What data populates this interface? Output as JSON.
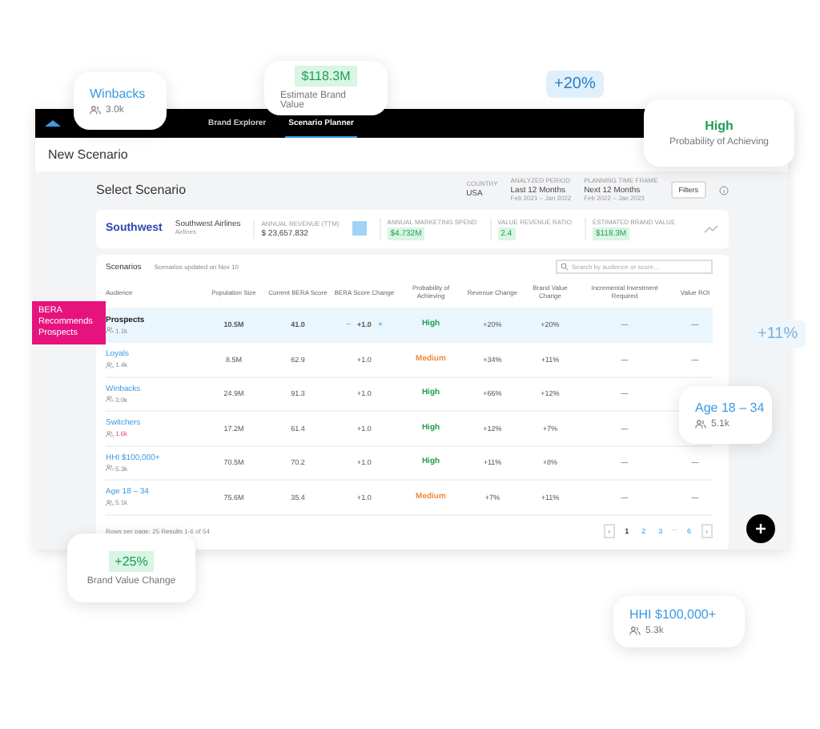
{
  "nav": {
    "tabs": [
      {
        "label": "Brand Explorer",
        "selected": false
      },
      {
        "label": "Scenario Planner",
        "selected": true
      }
    ]
  },
  "page_title": "New Scenario",
  "section_title": "Select Scenario",
  "context": [
    {
      "label": "COUNTRY",
      "value": "USA"
    },
    {
      "label": "ANALYZED PERIOD",
      "value": "Last 12 Months",
      "sub": "Feb 2021 – Jan 2022"
    },
    {
      "label": "PLANNING TIME FRAME",
      "value": "Next 12 Months",
      "sub": "Feb 2022 – Jan 2023"
    }
  ],
  "filters_button": "Filters",
  "brand": {
    "logo": "Southwest",
    "name": "Southwest Airlines",
    "category": "Airlines",
    "revenue_label": "ANNUAL REVENUE (TTM)",
    "currency": "$",
    "revenue": "23,657,832",
    "metrics": [
      {
        "label": "ANNUAL MARKETING SPEND",
        "value": "$4.732M"
      },
      {
        "label": "VALUE REVENUE RATIO",
        "value": "2.4"
      },
      {
        "label": "ESTIMATED BRAND VALUE",
        "value": "$118.3M"
      }
    ]
  },
  "scenarios": {
    "title": "Scenarios",
    "updated": "Scenarios updated on Nov 10",
    "search_placeholder": "Search by audience or score...",
    "columns": [
      "Audience",
      "Population Size",
      "Current BERA Score",
      "BERA Score Change",
      "Probability of Achieving",
      "Revenue Change",
      "Brand Value Change",
      "Incremental Investment Required",
      "Value ROI"
    ],
    "rows": [
      {
        "audience": "Prospects",
        "count": "1.1k",
        "flagged": false,
        "selected": true,
        "population": "10.5M",
        "score": "41.0",
        "minus": "−",
        "change": "+1.0",
        "plus": "+",
        "probability": "High",
        "color": "#1f9d55",
        "revenue": "+20%",
        "brand_value": "+20%",
        "investment": "—",
        "roi": "—"
      },
      {
        "audience": "Loyals",
        "count": "1.4k",
        "flagged": false,
        "selected": false,
        "population": "8.5M",
        "score": "62.9",
        "change": "+1.0",
        "probability": "Medium",
        "color": "#f08a3c",
        "revenue": "+34%",
        "brand_value": "+11%",
        "investment": "—",
        "roi": "—"
      },
      {
        "audience": "Winbacks",
        "count": "3.0k",
        "flagged": false,
        "selected": false,
        "population": "24.9M",
        "score": "91.3",
        "change": "+1.0",
        "probability": "High",
        "color": "#1f9d55",
        "revenue": "+66%",
        "brand_value": "+12%",
        "investment": "—"
      },
      {
        "audience": "Switchers",
        "count": "1.6k",
        "flagged": true,
        "selected": false,
        "population": "17.2M",
        "score": "61.4",
        "change": "+1.0",
        "probability": "High",
        "color": "#1f9d55",
        "revenue": "+12%",
        "brand_value": "+7%",
        "investment": "—"
      },
      {
        "audience": "HHI $100,000+",
        "count": "5.3k",
        "flagged": false,
        "selected": false,
        "population": "70.5M",
        "score": "70.2",
        "change": "+1.0",
        "probability": "High",
        "color": "#1f9d55",
        "revenue": "+11%",
        "brand_value": "+8%",
        "investment": "—",
        "roi": "—"
      },
      {
        "audience": "Age 18 – 34",
        "count": "5.1k",
        "flagged": false,
        "selected": false,
        "population": "75.6M",
        "score": "35.4",
        "change": "+1.0",
        "probability": "Medium",
        "color": "#f08a3c",
        "revenue": "+7%",
        "brand_value": "+11%",
        "investment": "—",
        "roi": "—"
      }
    ],
    "footer": "Rows per page: 25   Results 1-6 of 54",
    "pages": [
      {
        "label": "‹",
        "kind": "arrow"
      },
      {
        "label": "1",
        "kind": "page",
        "selected": true
      },
      {
        "label": "2",
        "kind": "page",
        "selected": false
      },
      {
        "label": "3",
        "kind": "page",
        "selected": false
      },
      {
        "label": "...",
        "kind": "gap"
      },
      {
        "label": "6",
        "kind": "page",
        "selected": false
      },
      {
        "label": "›",
        "kind": "arrow"
      }
    ]
  },
  "callouts": [
    {
      "kind": "audience",
      "title": "Winbacks",
      "count": "3.0k"
    },
    {
      "kind": "metric",
      "value": "$118.3M",
      "label": "Estimate Brand Value"
    },
    {
      "kind": "chip",
      "value": "+20%"
    },
    {
      "kind": "probability",
      "value": "High",
      "label": "Probability of Achieving"
    },
    {
      "kind": "recommend",
      "text": "BERA Recommends Prospects"
    },
    {
      "kind": "chip",
      "value": "+11%"
    },
    {
      "kind": "audience",
      "title": "Age 18 – 34",
      "count": "5.1k"
    },
    {
      "kind": "metric",
      "value": "+25%",
      "label": "Brand Value Change"
    },
    {
      "kind": "audience",
      "title": "HHI $100,000+",
      "count": "5.3k"
    }
  ]
}
